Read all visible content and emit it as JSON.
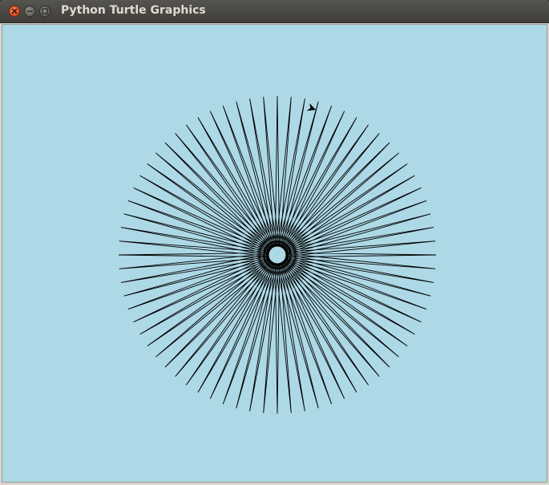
{
  "window": {
    "title": "Python Turtle Graphics",
    "close_icon": "close-icon",
    "minimize_icon": "minimize-icon",
    "maximize_icon": "maximize-icon"
  },
  "canvas": {
    "background_color": "#add8e6",
    "pen_color": "#000000",
    "pattern": "star-burst",
    "turtle_icon": "turtle-arrow-icon"
  }
}
